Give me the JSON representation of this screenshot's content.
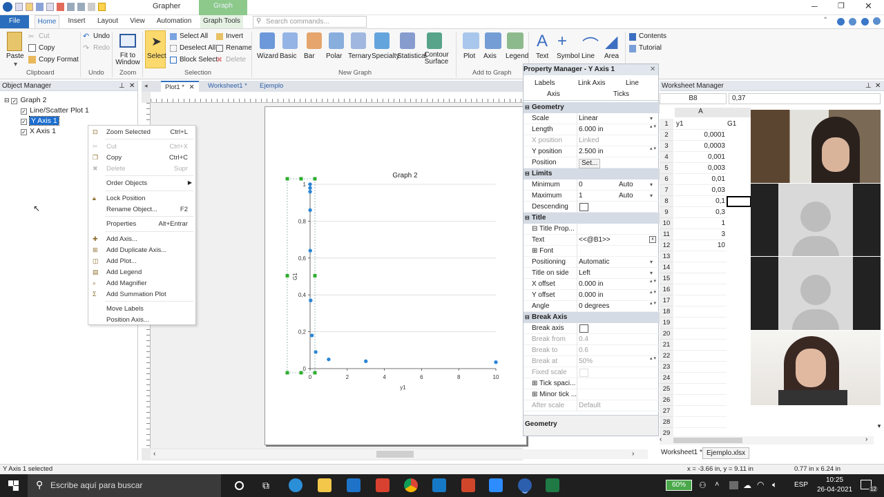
{
  "app": {
    "title": "Grapher",
    "contextual": "Graph"
  },
  "ribbon_tabs": [
    "File",
    "Home",
    "Insert",
    "Layout",
    "View",
    "Automation",
    "Graph Tools"
  ],
  "search": {
    "placeholder": "Search commands..."
  },
  "ribbon": {
    "clipboard": {
      "paste": "Paste",
      "cut": "Cut",
      "copy": "Copy",
      "copy_format": "Copy Format",
      "group": "Clipboard"
    },
    "undo": {
      "undo": "Undo",
      "redo": "Redo",
      "group": "Undo"
    },
    "zoom": {
      "fit": "Fit to Window",
      "group": "Zoom"
    },
    "selection": {
      "select": "Select",
      "select_all": "Select All",
      "deselect_all": "Deselect All",
      "block_select": "Block Select",
      "invert": "Invert",
      "rename": "Rename",
      "delete": "Delete",
      "group": "Selection"
    },
    "new_graph": {
      "items": [
        "Wizard",
        "Basic",
        "Bar",
        "Polar",
        "Ternary",
        "Specialty",
        "Statistical",
        "Contour Surface"
      ],
      "group": "New Graph"
    },
    "add_to_graph": {
      "items": [
        "Plot",
        "Axis",
        "Legend"
      ],
      "group": "Add to Graph"
    },
    "draw": {
      "items": [
        "Text",
        "Symbol",
        "Line",
        "Area"
      ]
    },
    "help": {
      "contents": "Contents",
      "tutorial": "Tutorial"
    }
  },
  "object_manager": {
    "title": "Object Manager",
    "tree": [
      "Graph 2",
      "Line/Scatter Plot 1",
      "Y Axis 1",
      "X Axis 1"
    ]
  },
  "context_menu": [
    {
      "label": "Zoom Selected",
      "shortcut": "Ctrl+L",
      "enabled": true
    },
    {
      "label": "Cut",
      "shortcut": "Ctrl+X",
      "enabled": false
    },
    {
      "label": "Copy",
      "shortcut": "Ctrl+C",
      "enabled": true
    },
    {
      "label": "Delete",
      "shortcut": "Supr",
      "enabled": false
    },
    {
      "label": "Order Objects",
      "shortcut": "",
      "enabled": true
    },
    {
      "label": "Lock Position",
      "shortcut": "",
      "enabled": true
    },
    {
      "label": "Rename Object...",
      "shortcut": "F2",
      "enabled": true
    },
    {
      "label": "Properties",
      "shortcut": "Alt+Entrar",
      "enabled": true
    },
    {
      "label": "Add Axis...",
      "shortcut": "",
      "enabled": true
    },
    {
      "label": "Add Duplicate Axis...",
      "shortcut": "",
      "enabled": true
    },
    {
      "label": "Add Plot...",
      "shortcut": "",
      "enabled": true
    },
    {
      "label": "Add Legend",
      "shortcut": "",
      "enabled": true
    },
    {
      "label": "Add Magnifier",
      "shortcut": "",
      "enabled": true
    },
    {
      "label": "Add Summation Plot",
      "shortcut": "",
      "enabled": true
    },
    {
      "label": "Move Labels",
      "shortcut": "",
      "enabled": true
    },
    {
      "label": "Position Axis...",
      "shortcut": "",
      "enabled": true
    }
  ],
  "doc_tabs": [
    "Plot1 *",
    "Worksheet1 *",
    "Ejemplo"
  ],
  "chart_data": {
    "type": "scatter",
    "title": "Graph 2",
    "xlabel": "y1",
    "ylabel": "G1",
    "xlim": [
      0,
      10
    ],
    "ylim": [
      0,
      1
    ],
    "xticks": [
      0,
      2,
      4,
      6,
      8,
      10
    ],
    "yticks": [
      0,
      0.2,
      0.4,
      0.6,
      0.8,
      1
    ],
    "xtick_labels": [
      "0",
      "2",
      "4",
      "6",
      "8",
      "10"
    ],
    "ytick_labels": [
      "0",
      "0,2",
      "0,4",
      "0,6",
      "0,8",
      "1"
    ],
    "grid": true,
    "color": "#2b86d6",
    "x": [
      0.0001,
      0.0003,
      0.001,
      0.003,
      0.01,
      0.03,
      0.1,
      0.3,
      1,
      3,
      10
    ],
    "y": [
      1,
      0.98,
      0.96,
      0.86,
      0.64,
      0.37,
      0.18,
      0.09,
      0.05,
      0.04,
      0.035
    ]
  },
  "property_manager": {
    "title": "Property Manager - Y Axis 1",
    "tabs": [
      "Labels",
      "Link Axis",
      "Line",
      "Axis",
      "Ticks"
    ],
    "rows": [
      {
        "section": "Geometry"
      },
      {
        "label": "Scale",
        "value": "Linear"
      },
      {
        "label": "Length",
        "value": "6.000 in"
      },
      {
        "label": "X position",
        "value": "Linked",
        "gray": true
      },
      {
        "label": "Y position",
        "value": "2.500 in"
      },
      {
        "label": "Position",
        "value": "Set..."
      },
      {
        "section": "Limits"
      },
      {
        "label": "Minimum",
        "value": "0",
        "extra": "Auto"
      },
      {
        "label": "Maximum",
        "value": "1",
        "extra": "Auto"
      },
      {
        "label": "Descending",
        "value": ""
      },
      {
        "section": "Title"
      },
      {
        "label": "⊟ Title Prop...",
        "value": ""
      },
      {
        "label": "Text",
        "value": "<<@B1>>"
      },
      {
        "label": "⊞ Font",
        "value": ""
      },
      {
        "label": "Positioning",
        "value": "Automatic"
      },
      {
        "label": "Title on side",
        "value": "Left"
      },
      {
        "label": "X offset",
        "value": "0.000 in"
      },
      {
        "label": "Y offset",
        "value": "0.000 in"
      },
      {
        "label": "Angle",
        "value": "0 degrees"
      },
      {
        "section": "Break Axis"
      },
      {
        "label": "Break axis",
        "value": ""
      },
      {
        "label": "Break from",
        "value": "0.4",
        "gray": true
      },
      {
        "label": "Break to",
        "value": "0.6",
        "gray": true
      },
      {
        "label": "Break at",
        "value": "50%",
        "gray": true
      },
      {
        "label": "Fixed scale",
        "value": "",
        "gray": true
      },
      {
        "label": "⊞ Tick spaci...",
        "value": ""
      },
      {
        "label": "⊞ Minor tick ...",
        "value": ""
      },
      {
        "label": "After scale",
        "value": "Default",
        "gray": true
      }
    ],
    "footer": "Geometry"
  },
  "worksheet": {
    "title": "Worksheet Manager",
    "cell_ref": "B8",
    "cell_value": "0,37",
    "col_a": "A",
    "col_b": "G1",
    "row_numbers": [
      "1",
      "2",
      "3",
      "4",
      "5",
      "6",
      "7",
      "8",
      "9",
      "10",
      "11",
      "12",
      "13",
      "14",
      "15",
      "16",
      "17",
      "18",
      "19",
      "20",
      "21",
      "22",
      "23",
      "24",
      "25",
      "26",
      "27",
      "28",
      "29"
    ],
    "a_values": [
      "y1",
      "0,0001",
      "0,0003",
      "0,001",
      "0,003",
      "0,01",
      "0,03",
      "0,1",
      "0,3",
      "1",
      "3",
      "10"
    ],
    "tabs": [
      "Worksheet1 *",
      "Ejemplo.xlsx"
    ]
  },
  "status": {
    "left": "Y Axis 1 selected",
    "coords": "x = -3.66 in, y = 9.11 in",
    "size": "0.77 in x 6.24 in"
  },
  "taskbar": {
    "search": "Escribe aquí para buscar",
    "battery": "60%",
    "lang": "ESP",
    "time": "10:25",
    "date": "26-04-2021",
    "notif": "12"
  }
}
